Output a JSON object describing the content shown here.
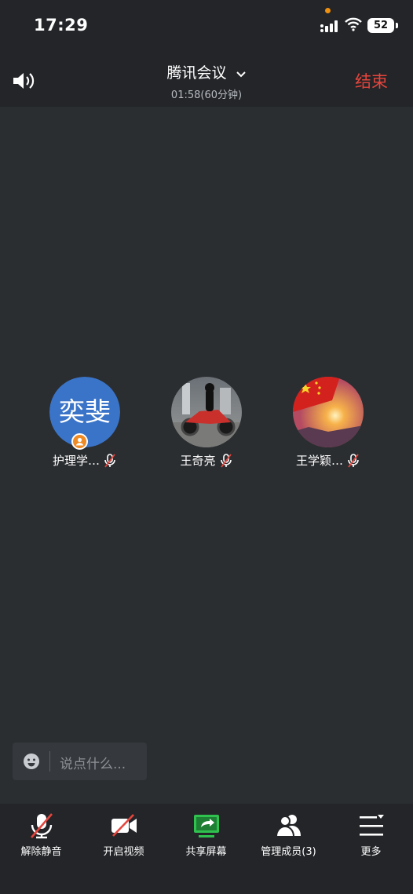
{
  "status_bar": {
    "time": "17:29",
    "battery": "52"
  },
  "header": {
    "title": "腾讯会议",
    "duration": "01:58(60分钟)",
    "end_label": "结束"
  },
  "participants": [
    {
      "name": "护理学…",
      "avatar_text": "奕斐",
      "avatar_color": "#3a74c9",
      "host": true,
      "muted": true
    },
    {
      "name": "王奇亮",
      "avatar": "motorcycle-photo",
      "muted": true
    },
    {
      "name": "王学颖…",
      "avatar": "flag-sunset-photo",
      "muted": true
    }
  ],
  "chat": {
    "placeholder": "说点什么..."
  },
  "toolbar": {
    "items": [
      {
        "label": "解除静音",
        "icon": "mic-off-icon"
      },
      {
        "label": "开启视频",
        "icon": "video-off-icon"
      },
      {
        "label": "共享屏幕",
        "icon": "share-screen-icon",
        "color": "#2fc24f"
      },
      {
        "label": "管理成员(3)",
        "icon": "members-icon"
      },
      {
        "label": "更多",
        "icon": "more-icon"
      }
    ]
  },
  "colors": {
    "end": "#e5453d",
    "host_badge": "#f08a24",
    "share_green": "#2fc24f"
  }
}
